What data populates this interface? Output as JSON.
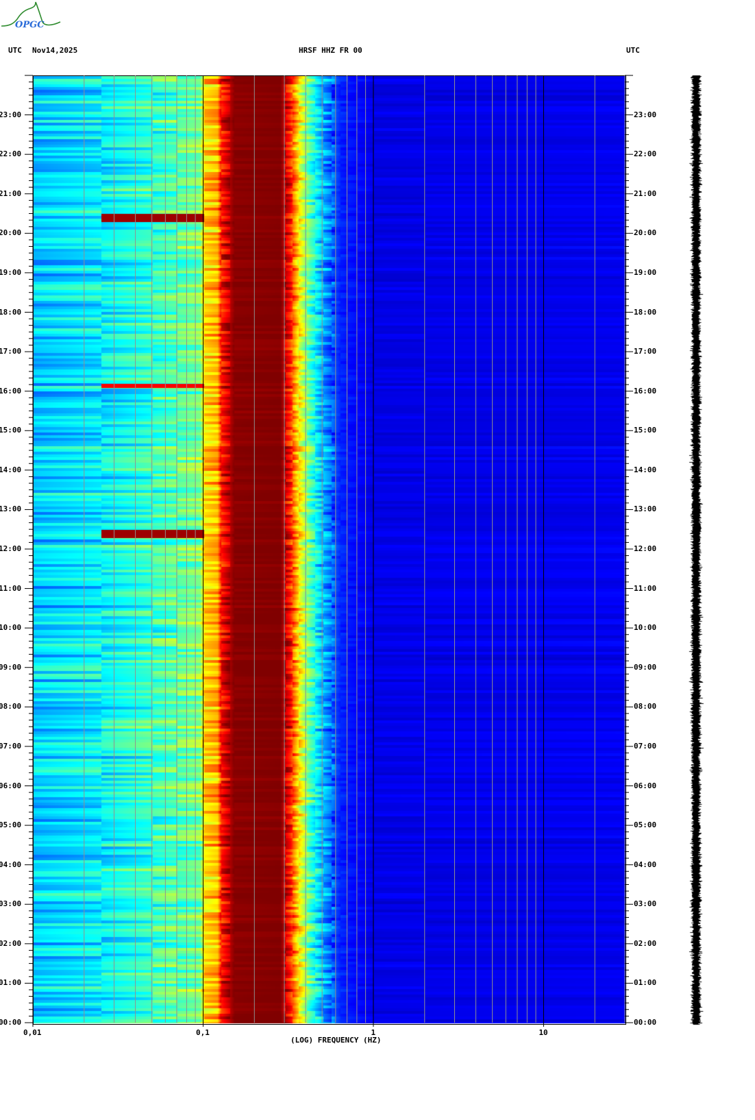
{
  "header": {
    "logo_text": "OPGC",
    "left_tz": "UTC",
    "date": "Nov14,2025",
    "station": "HRSF HHZ FR 00",
    "right_tz": "UTC"
  },
  "chart_data": {
    "type": "heatmap",
    "title": "HRSF HHZ FR 00",
    "xlabel": "(LOG) FREQUENCY (HZ)",
    "ylabel": "UTC",
    "x_scale": "log",
    "xlim": [
      0.01,
      30
    ],
    "ylim_hours": [
      0,
      24
    ],
    "x_ticks": [
      "0,01",
      "0,1",
      "1",
      "10"
    ],
    "x_tick_values": [
      0.01,
      0.1,
      1,
      10
    ],
    "y_ticks": [
      "00:00",
      "01:00",
      "02:00",
      "03:00",
      "04:00",
      "05:00",
      "06:00",
      "07:00",
      "08:00",
      "09:00",
      "10:00",
      "11:00",
      "12:00",
      "13:00",
      "14:00",
      "15:00",
      "16:00",
      "17:00",
      "18:00",
      "19:00",
      "20:00",
      "21:00",
      "22:00",
      "23:00"
    ],
    "minor_y_tick_minutes": 10,
    "colormap": "jet",
    "spectral_profile": [
      {
        "freq_hz": 0.01,
        "level": 0.33
      },
      {
        "freq_hz": 0.025,
        "level": 0.37
      },
      {
        "freq_hz": 0.05,
        "level": 0.43
      },
      {
        "freq_hz": 0.095,
        "level": 0.5
      },
      {
        "freq_hz": 0.1,
        "level": 0.66
      },
      {
        "freq_hz": 0.12,
        "level": 0.7
      },
      {
        "freq_hz": 0.126,
        "level": 0.86
      },
      {
        "freq_hz": 0.15,
        "level": 0.99
      },
      {
        "freq_hz": 0.28,
        "level": 1.0
      },
      {
        "freq_hz": 0.32,
        "level": 0.86
      },
      {
        "freq_hz": 0.36,
        "level": 0.65
      },
      {
        "freq_hz": 0.42,
        "level": 0.45
      },
      {
        "freq_hz": 0.5,
        "level": 0.3
      },
      {
        "freq_hz": 0.63,
        "level": 0.16
      },
      {
        "freq_hz": 1.0,
        "level": 0.1
      },
      {
        "freq_hz": 30,
        "level": 0.11
      }
    ],
    "events": [
      {
        "time": "20:25",
        "freq_range_hz": [
          0.025,
          0.1
        ],
        "level": 0.97
      },
      {
        "time": "16:10",
        "freq_range_hz": [
          0.025,
          0.1
        ],
        "level": 0.88
      },
      {
        "time": "12:25",
        "freq_range_hz": [
          0.025,
          0.1
        ],
        "level": 0.97
      }
    ],
    "grid": true
  }
}
